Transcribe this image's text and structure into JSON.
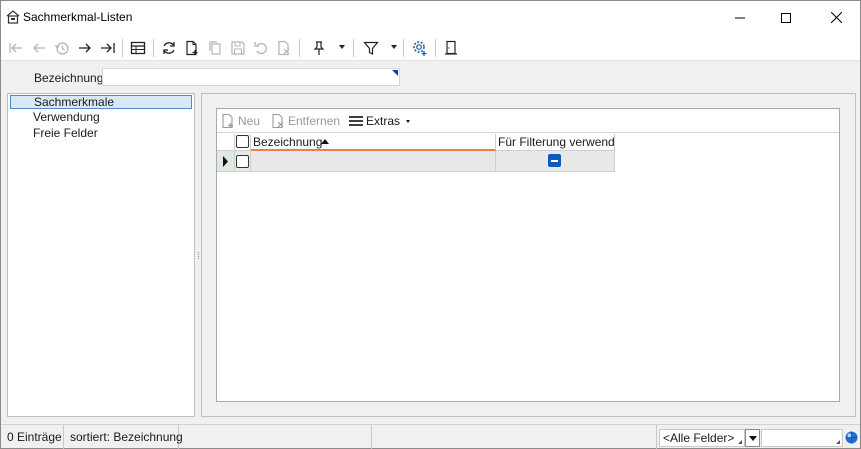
{
  "window": {
    "title": "Sachmerkmal-Listen"
  },
  "toolbar": {
    "buttons": [
      {
        "name": "first-record",
        "enabled": false
      },
      {
        "name": "previous-record",
        "enabled": false
      },
      {
        "name": "history",
        "enabled": false
      },
      {
        "name": "next-record",
        "enabled": true
      },
      {
        "name": "last-record",
        "enabled": true
      },
      {
        "name": "table-view",
        "enabled": true
      },
      {
        "name": "refresh",
        "enabled": true
      },
      {
        "name": "new-record",
        "enabled": true
      },
      {
        "name": "copy-record",
        "enabled": false
      },
      {
        "name": "save",
        "enabled": false
      },
      {
        "name": "undo",
        "enabled": false
      },
      {
        "name": "delete",
        "enabled": false
      },
      {
        "name": "pin",
        "enabled": true
      },
      {
        "name": "filter",
        "enabled": true
      },
      {
        "name": "settings",
        "enabled": true
      },
      {
        "name": "exit",
        "enabled": true
      }
    ]
  },
  "filter": {
    "label": "Bezeichnung",
    "value": ""
  },
  "nav": {
    "items": [
      {
        "label": "Sachmerkmale",
        "selected": true
      },
      {
        "label": "Verwendung",
        "selected": false
      },
      {
        "label": "Freie Felder",
        "selected": false
      }
    ]
  },
  "subtoolbar": {
    "new_label": "Neu",
    "remove_label": "Entfernen",
    "extras_label": "Extras"
  },
  "grid": {
    "columns": [
      {
        "label": "Bezeichnung",
        "sorted": "ascending"
      },
      {
        "label": "Für Filterung verwendbar"
      }
    ],
    "rows": [
      {
        "bezeichnung": "",
        "filter_state": "indeterminate"
      }
    ]
  },
  "statusbar": {
    "count": "0 Einträge",
    "sort": "sortiert: Bezeichnung",
    "field_select": "<Alle Felder>",
    "search_value": ""
  },
  "colors": {
    "accent": "#0a5bbf",
    "selection_bg": "#d9e8f7",
    "selection_border": "#4d8ad0",
    "sort_underline": "#e8824a"
  }
}
